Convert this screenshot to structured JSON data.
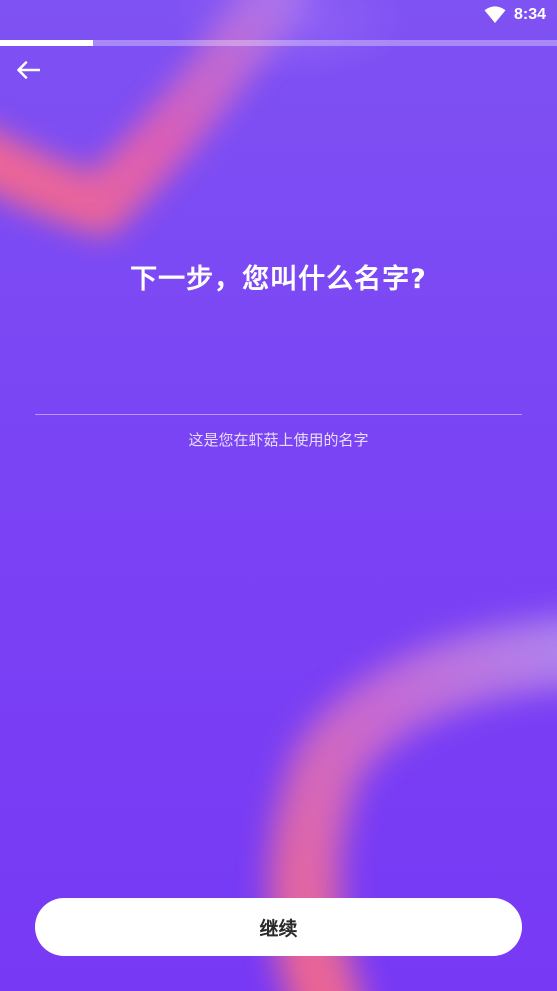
{
  "status_bar": {
    "time": "8:34",
    "wifi_icon": "wifi-icon"
  },
  "progress": {
    "fraction": 0.167
  },
  "header": {
    "back_icon": "arrow-left-icon"
  },
  "main": {
    "title": "下一步，您叫什么名字?",
    "name_input": {
      "value": "",
      "placeholder": ""
    },
    "helper_text": "这是您在虾菇上使用的名字"
  },
  "footer": {
    "continue_label": "继续"
  },
  "colors": {
    "background_top": "#7f52f3",
    "background_bottom": "#7839f5",
    "accent_stroke": "#ff6b7f",
    "button_bg": "#ffffff",
    "button_text": "#2a2a2a"
  }
}
